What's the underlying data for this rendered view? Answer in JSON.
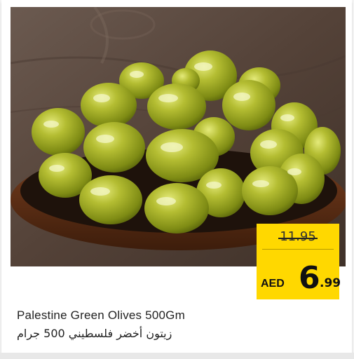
{
  "product": {
    "name_en": "Palestine Green Olives 500Gm",
    "name_ar": "زيتون أخضر فلسطيني 500 جرام",
    "image_icon": "green-olives-bowl-image"
  },
  "price": {
    "old": "11.95",
    "currency": "AED",
    "integer": "6",
    "decimal": ".99"
  },
  "colors": {
    "price_tag": "#ffd800",
    "olive": "#a9b42a",
    "background_wood": "#5a4a40"
  }
}
